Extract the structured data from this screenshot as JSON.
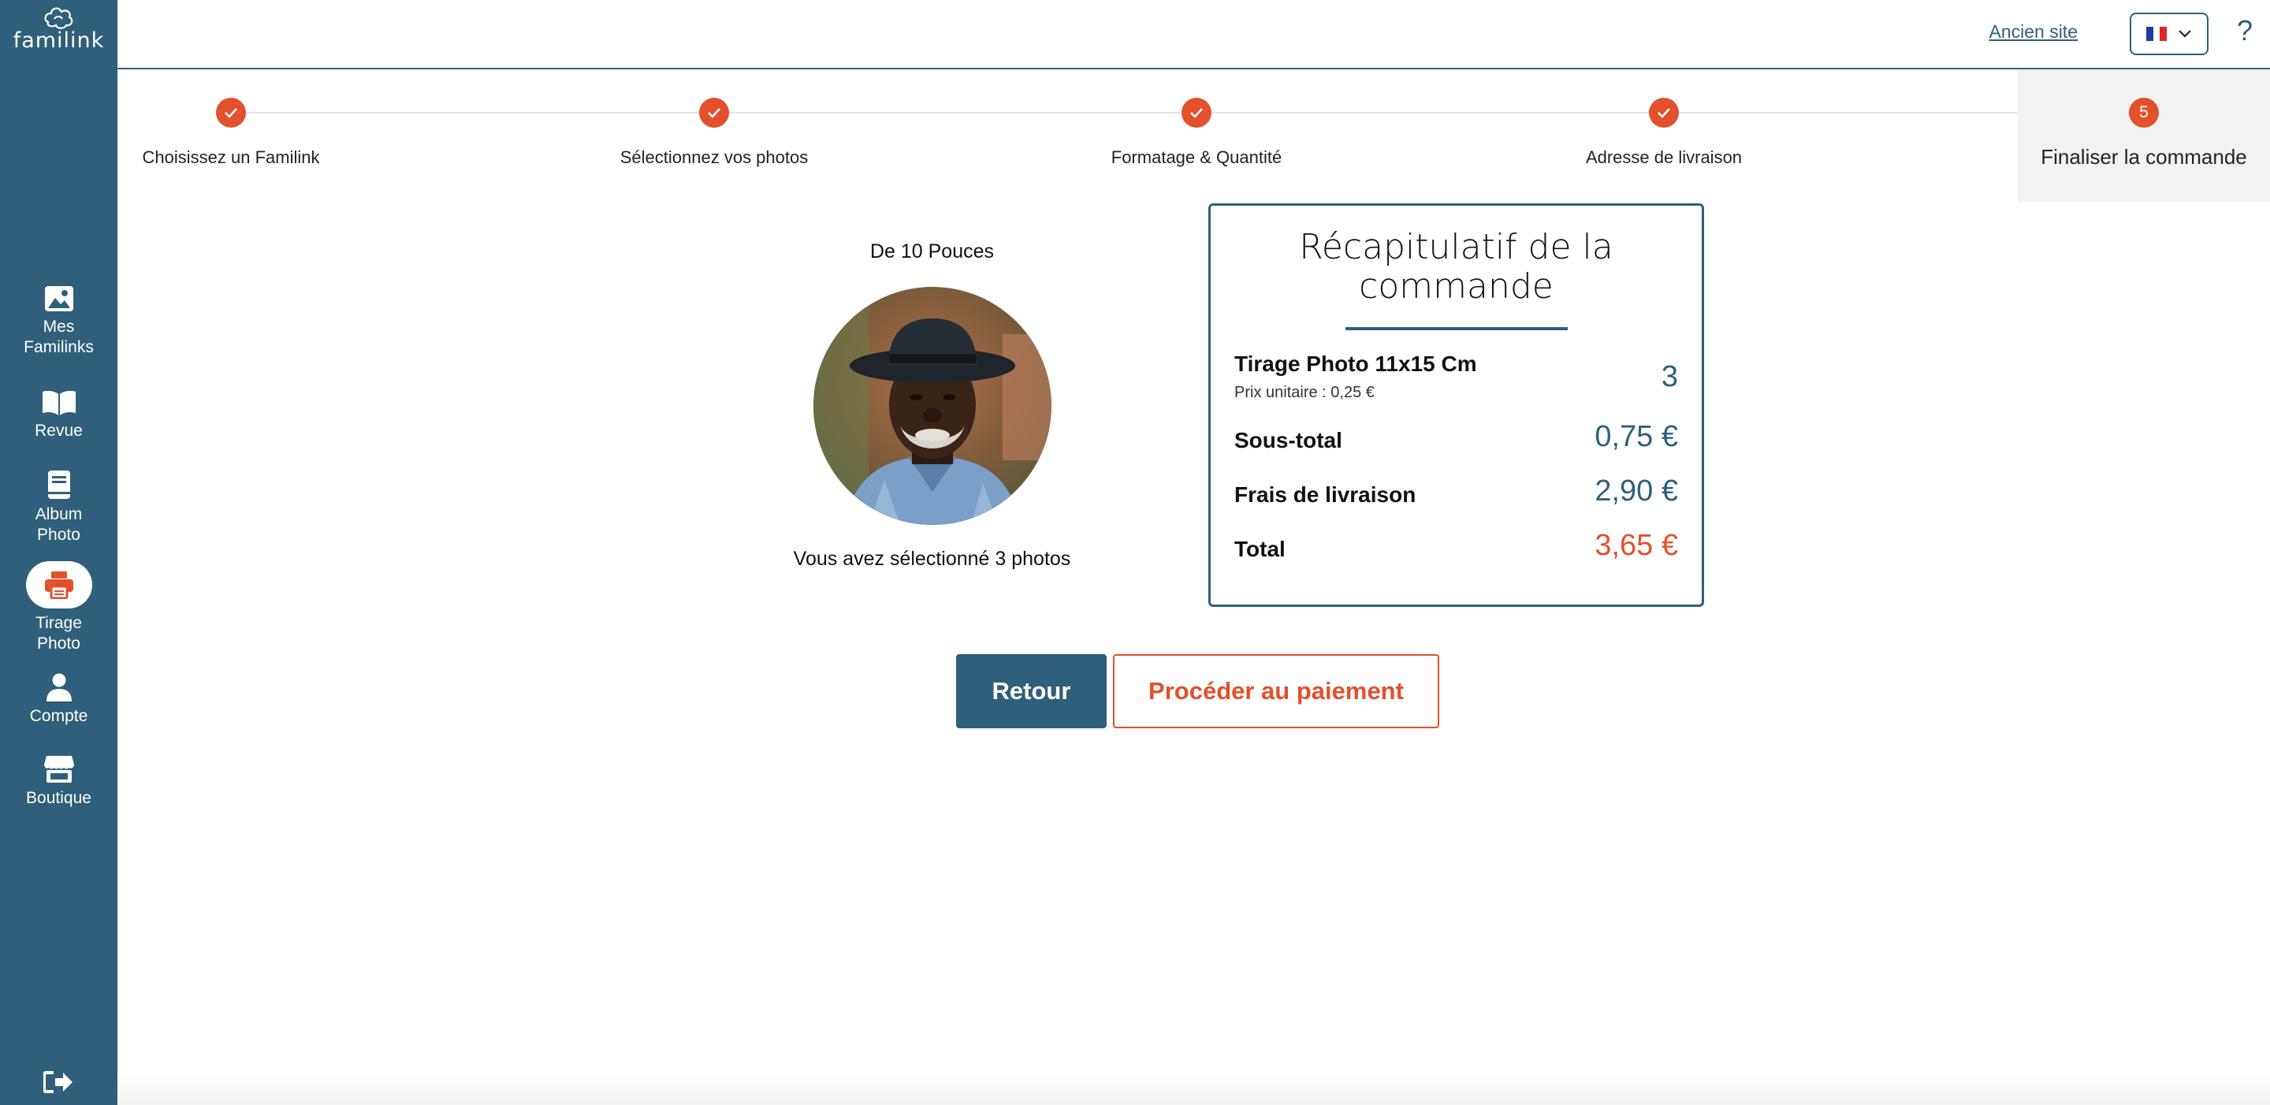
{
  "app": {
    "logo_text": "familink"
  },
  "sidebar": {
    "items": [
      {
        "label_1": "Mes",
        "label_2": "Familinks",
        "icon": "image-icon"
      },
      {
        "label_1": "Revue",
        "icon": "book-icon"
      },
      {
        "label_1": "Album",
        "label_2": "Photo",
        "icon": "album-icon"
      },
      {
        "label_1": "Tirage",
        "label_2": "Photo",
        "icon": "printer-icon",
        "active": true
      },
      {
        "label_1": "Compte",
        "icon": "user-icon"
      },
      {
        "label_1": "Boutique",
        "icon": "store-icon"
      }
    ],
    "logout_icon": "logout-icon"
  },
  "header": {
    "old_site_link": "Ancien site",
    "language": "FR",
    "help": "?"
  },
  "steps": [
    {
      "label": "Choisissez un Familink",
      "done": true
    },
    {
      "label": "Sélectionnez vos photos",
      "done": true
    },
    {
      "label": "Formatage & Quantité",
      "done": true
    },
    {
      "label": "Adresse de livraison",
      "done": true
    },
    {
      "label": "Finaliser la commande",
      "number": "5",
      "current": true
    }
  ],
  "product": {
    "title": "De 10 Pouces",
    "selection_text": "Vous avez sélectionné 3 photos"
  },
  "recap": {
    "title_line1": "Récapitulatif de la",
    "title_line2": "commande",
    "item_name": "Tirage Photo 11x15 Cm",
    "unit_price": "Prix unitaire : 0,25 €",
    "quantity": "3",
    "subtotal_label": "Sous-total",
    "subtotal_value": "0,75 €",
    "shipping_label": "Frais de livraison",
    "shipping_value": "2,90 €",
    "total_label": "Total",
    "total_value": "3,65 €"
  },
  "buttons": {
    "back": "Retour",
    "pay": "Procéder au paiement"
  },
  "colors": {
    "primary": "#2f5f7a",
    "accent": "#e2502c"
  }
}
